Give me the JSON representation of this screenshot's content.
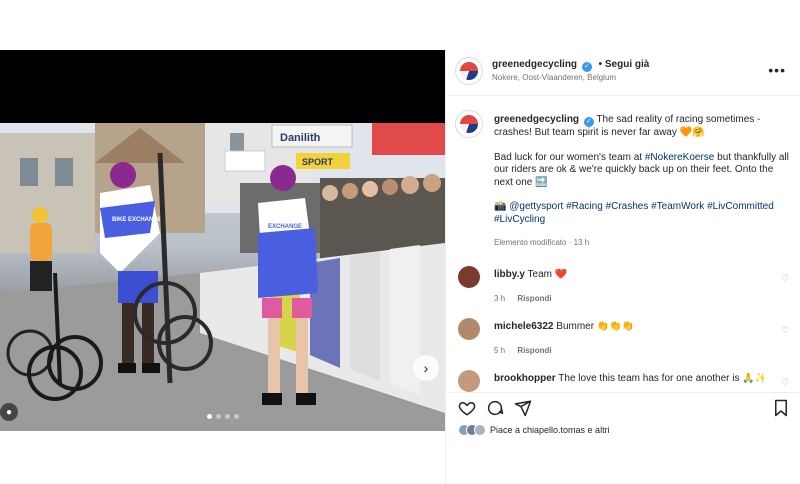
{
  "header": {
    "username": "greenedgecycling",
    "follow_label": "• Segui già",
    "location": "Nokere, Oost-Vlaanderen, Belgium",
    "more_icon": "more-icon"
  },
  "caption": {
    "username": "greenedgecycling",
    "line1": "The sad reality of racing sometimes - crashes! But team spirit is never far away 🧡🤗",
    "line2_pre": "Bad luck for our women's team at ",
    "line2_tag": "#NokereKoerse",
    "line2_post": " but thankfully all our riders are ok & we're quickly back up on their feet. Onto the next one 🔜",
    "credit_prefix": "📸 ",
    "credit_tag": "@gettysport",
    "hashtags": "#Racing #Crashes #TeamWork #LivCommitted #LivCycling",
    "edited": "Elemento modificato · 13 h"
  },
  "comments": [
    {
      "user": "libby.y",
      "text": "Team ❤️",
      "time": "3 h",
      "reply": "Rispondi",
      "avatar_color": "#7a3b2e"
    },
    {
      "user": "michele6322",
      "text": "Bummer 👏👏👏",
      "time": "5 h",
      "reply": "Rispondi",
      "avatar_color": "#b08a6a"
    },
    {
      "user": "brookhopper",
      "text": "The love this team has for one another is 🙏✨",
      "time": "",
      "reply": "",
      "avatar_color": "#c49a7a"
    }
  ],
  "actions": {
    "like_icon": "heart-icon",
    "comment_icon": "comment-icon",
    "share_icon": "share-icon",
    "save_icon": "bookmark-icon"
  },
  "likes": {
    "text": "Piace a chiapello.tomas e altri"
  },
  "media": {
    "ad_text_1": "Danilith",
    "ad_text_2": "SPORT",
    "jersey_text_1": "BIKE EXCHANGE",
    "jersey_text_2": "EXCHANGE",
    "carousel_dots": 4,
    "active_dot": 1
  },
  "colors": {
    "accent": "#3897f0",
    "link": "#00376b",
    "jersey_blue": "#4a5ee0",
    "jersey_pink": "#e05aa0"
  }
}
